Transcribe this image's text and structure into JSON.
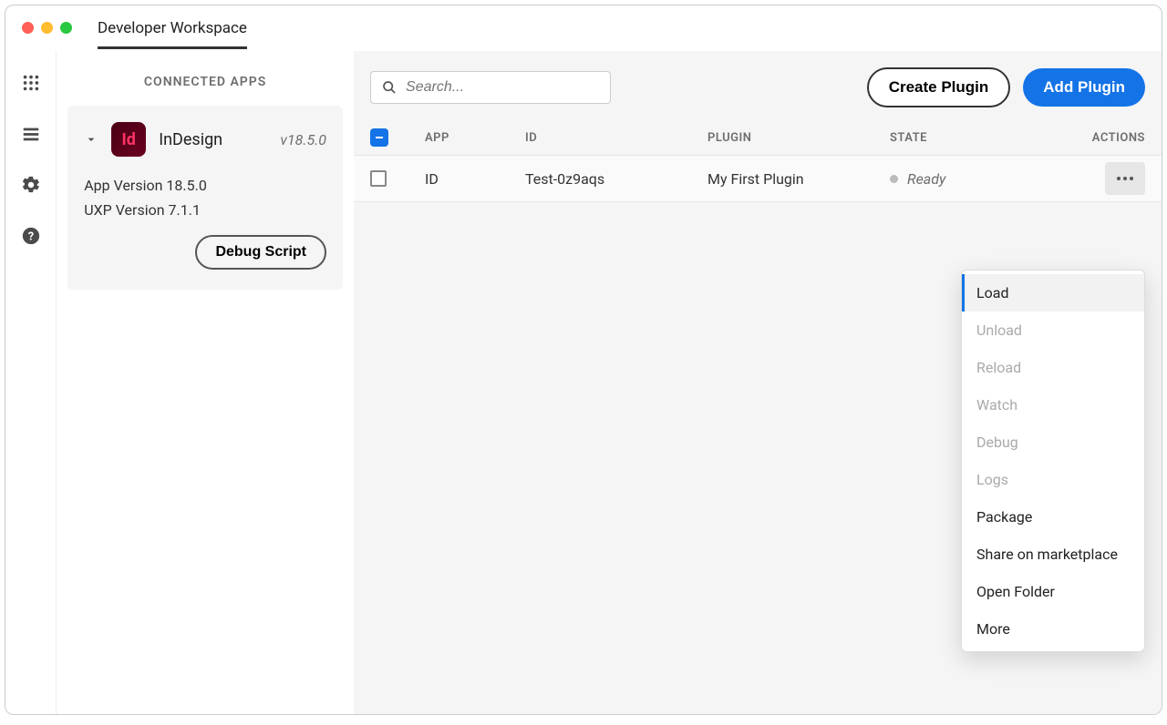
{
  "window": {
    "title": "Developer Workspace"
  },
  "sidebar": {
    "title": "CONNECTED APPS",
    "app": {
      "icon_label": "Id",
      "name": "InDesign",
      "version": "v18.5.0",
      "app_version": "App Version 18.5.0",
      "uxp_version": "UXP Version 7.1.1"
    },
    "debug_button": "Debug Script"
  },
  "toolbar": {
    "search_placeholder": "Search...",
    "create_plugin": "Create Plugin",
    "add_plugin": "Add Plugin"
  },
  "table": {
    "headers": {
      "app": "APP",
      "id": "ID",
      "plugin": "PLUGIN",
      "state": "STATE",
      "actions": "ACTIONS"
    },
    "rows": [
      {
        "app": "ID",
        "id": "Test-0z9aqs",
        "plugin": "My First Plugin",
        "state": "Ready"
      }
    ]
  },
  "menu": {
    "items": [
      {
        "label": "Load",
        "enabled": true,
        "highlight": true
      },
      {
        "label": "Unload",
        "enabled": false
      },
      {
        "label": "Reload",
        "enabled": false
      },
      {
        "label": "Watch",
        "enabled": false
      },
      {
        "label": "Debug",
        "enabled": false
      },
      {
        "label": "Logs",
        "enabled": false
      },
      {
        "label": "Package",
        "enabled": true
      },
      {
        "label": "Share on marketplace",
        "enabled": true
      },
      {
        "label": "Open Folder",
        "enabled": true
      },
      {
        "label": "More",
        "enabled": true
      }
    ]
  }
}
